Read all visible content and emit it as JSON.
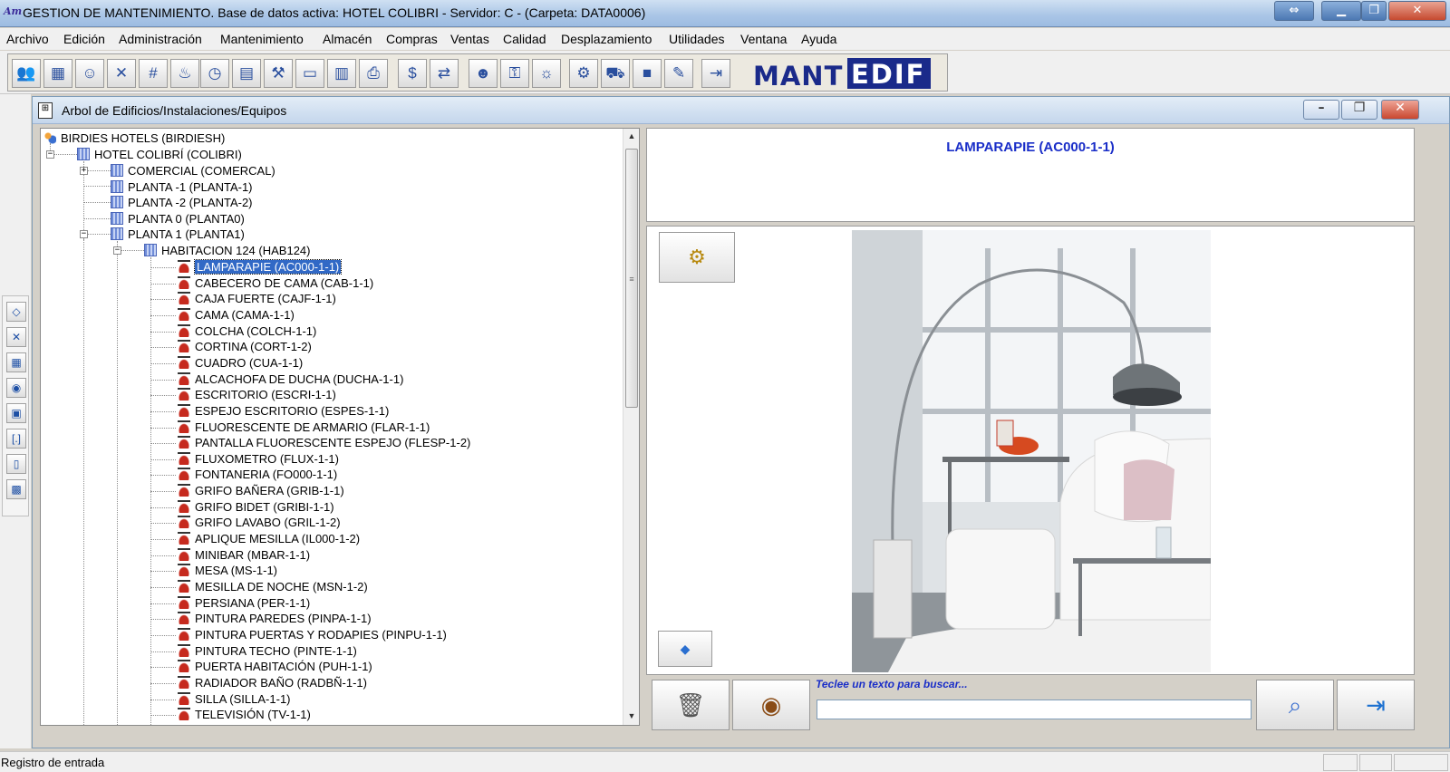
{
  "window": {
    "title": "GESTION DE MANTENIMIENTO. Base de datos activa: HOTEL COLIBRI - Servidor: C - (Carpeta: DATA0006)",
    "app_icon_text": "Am"
  },
  "menu": [
    "Archivo",
    "Edición",
    "Administración",
    "Mantenimiento",
    "Almacén",
    "Compras",
    "Ventas",
    "Calidad",
    "Desplazamiento",
    "Utilidades",
    "Ventana",
    "Ayuda"
  ],
  "logo": {
    "part1": "MANT",
    "part2": "EDIF"
  },
  "inner_window": {
    "title": "Arbol de Edificios/Instalaciones/Equipos"
  },
  "tree": {
    "root": "BIRDIES HOTELS (BIRDIESH)",
    "hotel": "HOTEL COLIBRÍ (COLIBRI)",
    "floors": [
      "COMERCIAL (COMERCAL)",
      "PLANTA -1 (PLANTA-1)",
      "PLANTA -2 (PLANTA-2)",
      "PLANTA 0 (PLANTA0)",
      "PLANTA 1 (PLANTA1)"
    ],
    "room": "HABITACION 124 (HAB124)",
    "items": [
      "LAMPARAPIE (AC000-1-1)",
      "CABECERO DE CAMA (CAB-1-1)",
      "CAJA FUERTE (CAJF-1-1)",
      "CAMA (CAMA-1-1)",
      "COLCHA (COLCH-1-1)",
      "CORTINA (CORT-1-2)",
      "CUADRO (CUA-1-1)",
      "ALCACHOFA DE DUCHA (DUCHA-1-1)",
      "ESCRITORIO (ESCRI-1-1)",
      "ESPEJO ESCRITORIO (ESPES-1-1)",
      "FLUORESCENTE DE ARMARIO (FLAR-1-1)",
      "PANTALLA FLUORESCENTE ESPEJO (FLESP-1-2)",
      "FLUXOMETRO (FLUX-1-1)",
      "FONTANERIA (FO000-1-1)",
      "GRIFO BAÑERA (GRIB-1-1)",
      "GRIFO BIDET (GRIBI-1-1)",
      "GRIFO LAVABO (GRIL-1-2)",
      "APLIQUE MESILLA (IL000-1-2)",
      "MINIBAR (MBAR-1-1)",
      "MESA (MS-1-1)",
      "MESILLA DE NOCHE (MSN-1-2)",
      "PERSIANA (PER-1-1)",
      "PINTURA PAREDES (PINPA-1-1)",
      "PINTURA PUERTAS Y RODAPIES (PINPU-1-1)",
      "PINTURA TECHO (PINTE-1-1)",
      "PUERTA HABITACIÓN (PUH-1-1)",
      "RADIADOR BAÑO (RADBÑ-1-1)",
      "SILLA (SILLA-1-1)",
      "TELEVISIÓN (TV-1-1)"
    ],
    "selected_index": 0
  },
  "detail": {
    "selected_title": "LAMPARAPIE (AC000-1-1)"
  },
  "search": {
    "label": "Teclee un texto para buscar...",
    "value": ""
  },
  "status": {
    "text": "Registro de entrada"
  },
  "colors": {
    "title_blue": "#1a2ec8",
    "selection": "#3169c6",
    "logo_blue": "#1a2a8a"
  }
}
